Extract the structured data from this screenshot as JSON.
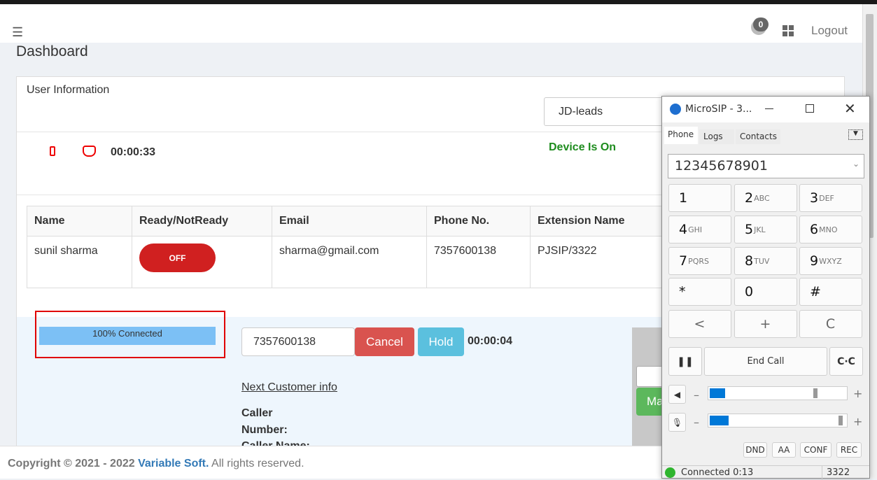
{
  "header": {
    "menu_icon": "hamburger-icon",
    "notification_count": "0",
    "apps_icon": "grid-icon",
    "logout": "Logout"
  },
  "page_title": "Dashboard",
  "user_info": {
    "title": "User Information",
    "campaign_select": "JD-leads",
    "timer": "00:00:33",
    "device_status": "Device Is On",
    "icons": [
      "mobile-icon",
      "hand-stop-icon"
    ]
  },
  "table": {
    "headers": [
      "Name",
      "Ready/NotReady",
      "Email",
      "Phone No.",
      "Extension Name"
    ],
    "rows": [
      {
        "name": "sunil sharma",
        "toggle": "OFF",
        "email": "sharma@gmail.com",
        "phone": "7357600138",
        "extension": "PJSIP/3322"
      }
    ]
  },
  "call": {
    "progress_label": "100% Connected",
    "progress": 100,
    "number": "7357600138",
    "cancel": "Cancel",
    "hold": "Hold",
    "timer": "00:00:04",
    "next_customer": "Next Customer info",
    "caller_number_label": "Caller Number:",
    "caller_name_label": "Caller Name:",
    "side_button": "Ma"
  },
  "footer": {
    "copyright": "Copyright © 2021 - 2022 ",
    "company": "Variable Soft.",
    "rights": " All rights reserved."
  },
  "colors": {
    "danger": "#d9534f",
    "info": "#5bc0de",
    "success": "#1e8c1e",
    "progress": "#7cc0f5",
    "highlight_border": "#e00000"
  },
  "microsip": {
    "title": "MicroSIP - 3...",
    "tabs": [
      "Phone",
      "Logs",
      "Contacts"
    ],
    "dial_value": "12345678901",
    "keys": [
      [
        "1",
        ""
      ],
      [
        "2",
        "ABC"
      ],
      [
        "3",
        "DEF"
      ],
      [
        "4",
        "GHI"
      ],
      [
        "5",
        "JKL"
      ],
      [
        "6",
        "MNO"
      ],
      [
        "7",
        "PQRS"
      ],
      [
        "8",
        "TUV"
      ],
      [
        "9",
        "WXYZ"
      ],
      [
        "*",
        ""
      ],
      [
        "0",
        ""
      ],
      [
        "#",
        ""
      ],
      [
        "<",
        ""
      ],
      [
        "+",
        ""
      ],
      [
        "C",
        ""
      ]
    ],
    "end_call": "End Call",
    "speaker_volume": 78,
    "speaker_level": 11,
    "mic_volume": 97,
    "mic_level": 14,
    "buttons": [
      "DND",
      "AA",
      "CONF",
      "REC"
    ],
    "status": "Connected 0:13",
    "extension": "3322"
  }
}
